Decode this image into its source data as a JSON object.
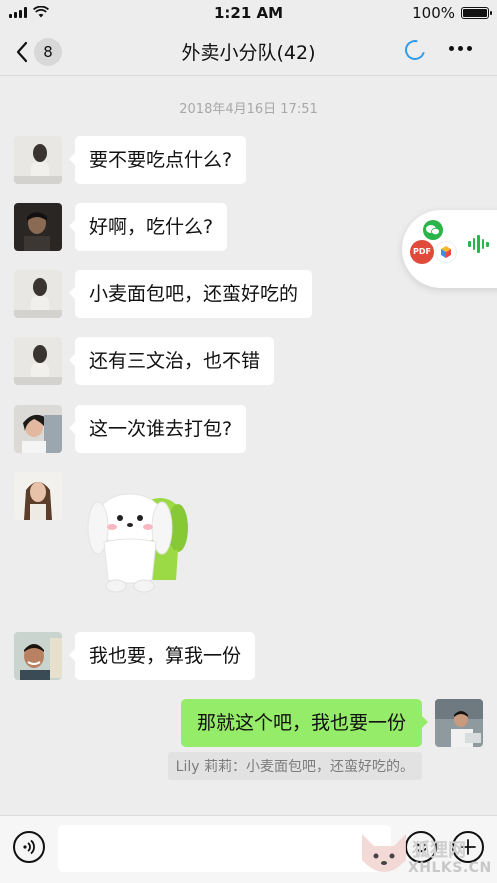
{
  "status_bar": {
    "time": "1:21 AM",
    "battery_label": "100%",
    "battery_level": 1.0
  },
  "nav": {
    "back_count": "8",
    "title": "外卖小分队(42)"
  },
  "chat": {
    "timestamp": "2018年4月16日 17:51",
    "messages": [
      {
        "text": "要不要吃点什么?"
      },
      {
        "text": "好啊，吃什么?"
      },
      {
        "text": "小麦面包吧，还蛮好吃的"
      },
      {
        "text": "还有三文治，也不错"
      },
      {
        "text": "这一次谁去打包?"
      },
      {
        "text": "我也要，算我一份"
      }
    ],
    "self_message": "那就这个吧，我也要一份",
    "quote": "Lily 莉莉：小麦面包吧，还蛮好吃的。"
  },
  "floating_window": {
    "pdf_label": "PDF"
  },
  "watermark": {
    "text": "XHLKS.CN"
  },
  "colors": {
    "background": "#EDEDED",
    "self_bubble": "#95EC69",
    "accent_green": "#2BB44A",
    "loader_blue": "#2F9BEB"
  }
}
